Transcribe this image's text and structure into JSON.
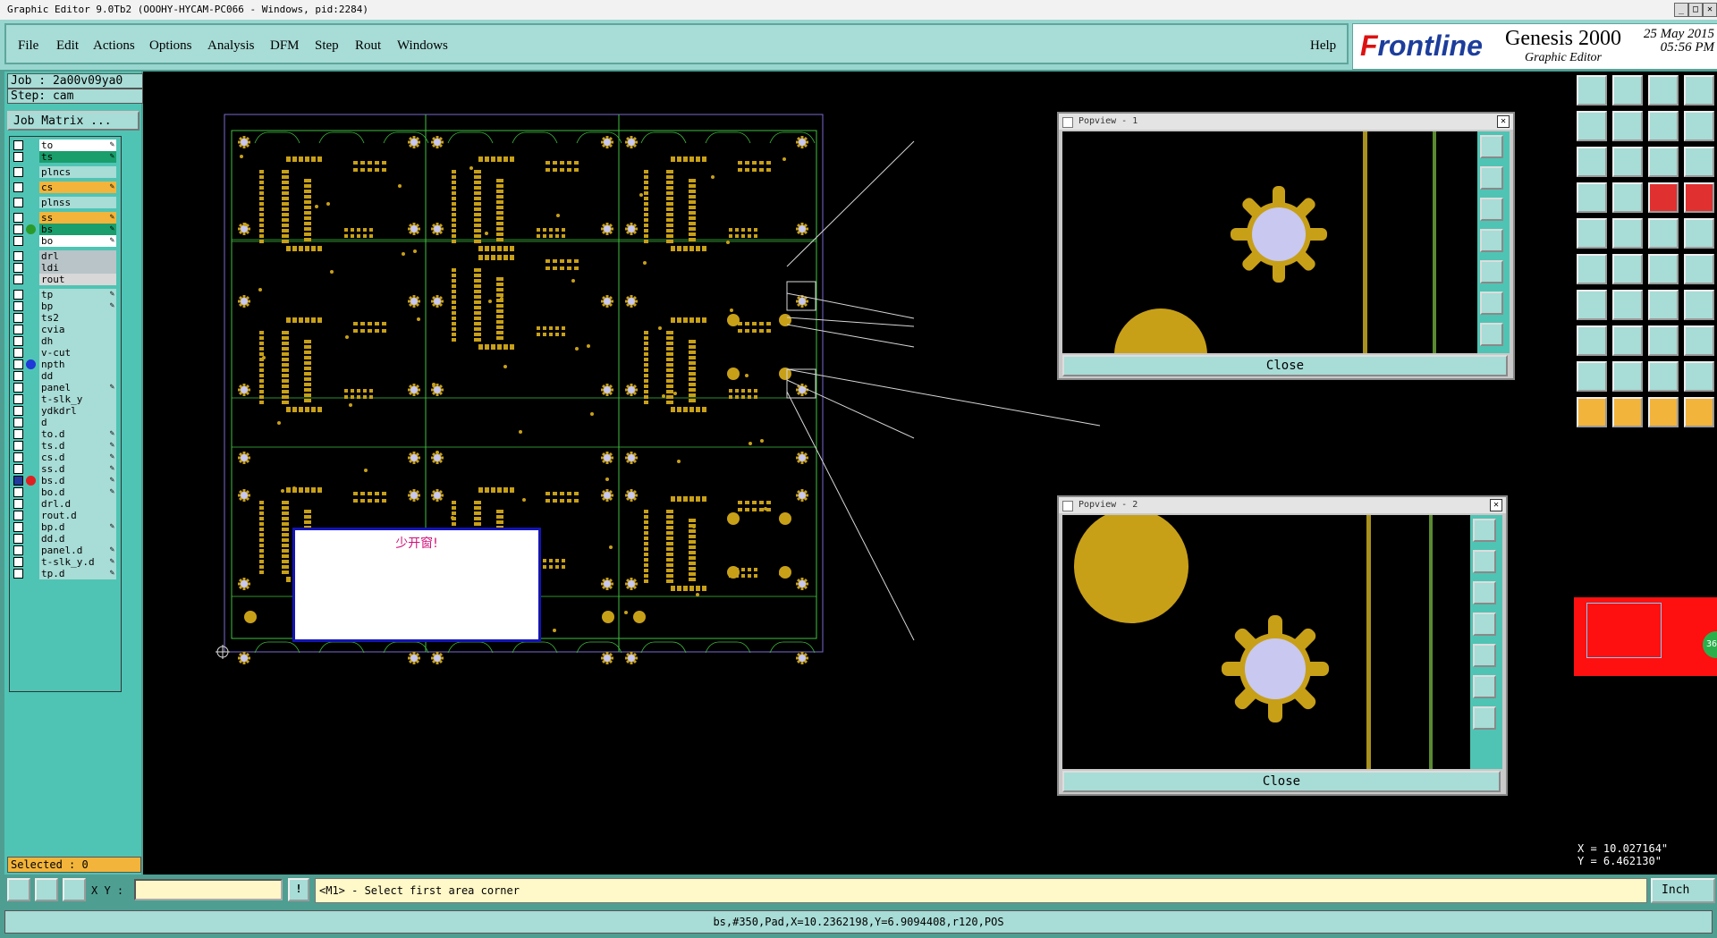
{
  "window": {
    "title": "Graphic Editor 9.0Tb2 (OOOHY-HYCAM-PC066 - Windows, pid:2284)"
  },
  "menu": {
    "items": [
      "File",
      "Edit",
      "Actions",
      "Options",
      "Analysis",
      "DFM",
      "Step",
      "Rout",
      "Windows"
    ],
    "help": "Help"
  },
  "brand": {
    "logo_prefix": "F",
    "logo_rest": "rontline",
    "product": "Genesis 2000",
    "subtitle": "Graphic Editor",
    "date": "25 May 2015",
    "time": "05:56 PM"
  },
  "job": {
    "job_line": "Job : 2a00v09ya0",
    "step_line": "Step: cam",
    "matrix_button": "Job Matrix ..."
  },
  "layers": [
    {
      "name": "to",
      "color": "#ffffff",
      "group": 0,
      "edit": true
    },
    {
      "name": "ts",
      "color": "#1a9e6c",
      "group": 0,
      "edit": true
    },
    {
      "name": "plncs",
      "color": "#a8dcd6",
      "group": 1,
      "edit": false
    },
    {
      "name": "cs",
      "color": "#f2b43a",
      "group": 2,
      "edit": true
    },
    {
      "name": "plnss",
      "color": "#a8dcd6",
      "group": 3,
      "edit": false
    },
    {
      "name": "ss",
      "color": "#f2b43a",
      "group": 4,
      "edit": true
    },
    {
      "name": "bs",
      "color": "#1a9e6c",
      "group": 4,
      "edit": true,
      "dot": "#2a9a2a"
    },
    {
      "name": "bo",
      "color": "#ffffff",
      "group": 4,
      "edit": true
    },
    {
      "name": "drl",
      "color": "#b8c4c8",
      "group": 5,
      "edit": false
    },
    {
      "name": "ldi",
      "color": "#b8c4c8",
      "group": 5,
      "edit": false
    },
    {
      "name": "rout",
      "color": "#d8d8d8",
      "group": 5,
      "edit": false
    },
    {
      "name": "tp",
      "color": "#a8dcd6",
      "group": 6,
      "edit": true
    },
    {
      "name": "bp",
      "color": "#a8dcd6",
      "group": 6,
      "edit": true
    },
    {
      "name": "ts2",
      "color": "#a8dcd6",
      "group": 6,
      "edit": false
    },
    {
      "name": "cvia",
      "color": "#a8dcd6",
      "group": 6,
      "edit": false
    },
    {
      "name": "dh",
      "color": "#a8dcd6",
      "group": 6,
      "edit": false
    },
    {
      "name": "v-cut",
      "color": "#a8dcd6",
      "group": 6,
      "edit": false
    },
    {
      "name": "npth",
      "color": "#a8dcd6",
      "group": 6,
      "edit": false,
      "dot": "#1f3ad8"
    },
    {
      "name": "dd",
      "color": "#a8dcd6",
      "group": 6,
      "edit": false
    },
    {
      "name": "panel",
      "color": "#a8dcd6",
      "group": 6,
      "edit": true
    },
    {
      "name": "t-slk_y",
      "color": "#a8dcd6",
      "group": 6,
      "edit": false
    },
    {
      "name": "ydkdrl",
      "color": "#a8dcd6",
      "group": 6,
      "edit": false
    },
    {
      "name": "d",
      "color": "#a8dcd6",
      "group": 6,
      "edit": false
    },
    {
      "name": "to.d",
      "color": "#a8dcd6",
      "group": 6,
      "edit": true
    },
    {
      "name": "ts.d",
      "color": "#a8dcd6",
      "group": 6,
      "edit": true
    },
    {
      "name": "cs.d",
      "color": "#a8dcd6",
      "group": 6,
      "edit": true
    },
    {
      "name": "ss.d",
      "color": "#a8dcd6",
      "group": 6,
      "edit": true
    },
    {
      "name": "bs.d",
      "color": "#a8dcd6",
      "group": 6,
      "edit": true,
      "dot": "#e02020",
      "checked": true
    },
    {
      "name": "bo.d",
      "color": "#a8dcd6",
      "group": 6,
      "edit": true
    },
    {
      "name": "drl.d",
      "color": "#a8dcd6",
      "group": 6,
      "edit": false
    },
    {
      "name": "rout.d",
      "color": "#a8dcd6",
      "group": 6,
      "edit": false
    },
    {
      "name": "bp.d",
      "color": "#a8dcd6",
      "group": 6,
      "edit": true
    },
    {
      "name": "dd.d",
      "color": "#a8dcd6",
      "group": 6,
      "edit": false
    },
    {
      "name": "panel.d",
      "color": "#a8dcd6",
      "group": 6,
      "edit": true
    },
    {
      "name": "t-slk_y.d",
      "color": "#a8dcd6",
      "group": 6,
      "edit": true
    },
    {
      "name": "tp.d",
      "color": "#a8dcd6",
      "group": 6,
      "edit": true
    }
  ],
  "selected": "Selected : 0",
  "note": {
    "text": "少开窗!"
  },
  "popview1": {
    "title": "Popview - 1",
    "close_label": "Close"
  },
  "popview2": {
    "title": "Popview - 2",
    "close_label": "Close"
  },
  "coords": {
    "x": "X = 10.027164\"",
    "y": "Y =  6.462130\""
  },
  "side_badge": "36",
  "input": {
    "xy_label": "X Y :",
    "message": "<M1> - Select first area corner",
    "units": "Inch"
  },
  "status": "bs,#350,Pad,X=10.2362198,Y=6.9094408,r120,POS",
  "colors": {
    "pad": "#c8a018",
    "outline": "#3fbf3f",
    "panel_edge": "#7a6ad0",
    "highlight_pad": "#c8c8f0",
    "red_block": "#ff1010"
  }
}
